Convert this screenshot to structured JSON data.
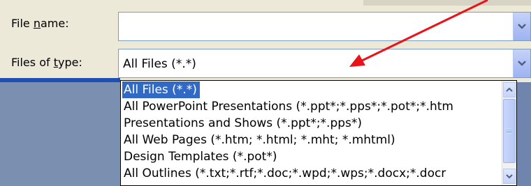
{
  "fields": {
    "file_name_label_pre": "File ",
    "file_name_label_u": "n",
    "file_name_label_post": "ame:",
    "file_name_value": "",
    "files_of_type_label_pre": "Files of ",
    "files_of_type_label_u": "t",
    "files_of_type_label_post": "ype:",
    "files_of_type_value": "All Files (*.*)"
  },
  "dropdown": {
    "options": [
      "All Files (*.*)",
      "All PowerPoint Presentations (*.ppt*;*.pps*;*.pot*;*.htm",
      "Presentations and Shows (*.ppt*;*.pps*)",
      "All Web Pages (*.htm; *.html; *.mht; *.mhtml)",
      "Design Templates (*.pot*)",
      "All Outlines (*.txt;*.rtf;*.doc;*.wpd;*.wps;*.docx;*.docr"
    ],
    "selected_index": 0
  },
  "colors": {
    "selection": "#316ac5",
    "annotation_arrow": "#e8141a",
    "dialog_bg": "#ece9d8"
  },
  "icons": [
    "chevron-down-icon",
    "scroll-up-icon",
    "scroll-down-icon",
    "annotation-arrow"
  ]
}
